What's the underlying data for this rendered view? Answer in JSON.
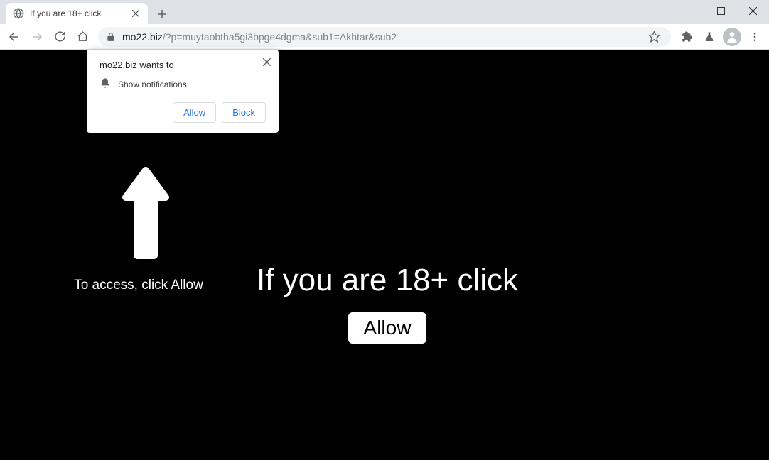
{
  "tab": {
    "title": "If you are 18+ click"
  },
  "omnibox": {
    "domain": "mo22.biz",
    "path": "/?p=muytaobtha5gi3bpge4dgma&sub1=Akhtar&sub2"
  },
  "notification": {
    "title": "mo22.biz wants to",
    "permission": "Show notifications",
    "allow": "Allow",
    "block": "Block"
  },
  "page": {
    "instruction": "To access, click Allow",
    "heading": "If you are 18+ click",
    "allow_button": "Allow"
  }
}
